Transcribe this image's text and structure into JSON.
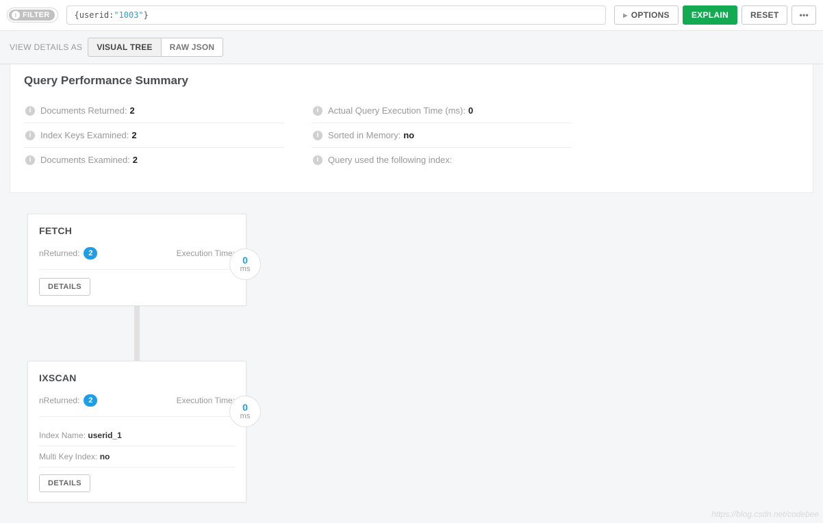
{
  "filter": {
    "badge": "FILTER",
    "query_key": "userid",
    "query_value": "\"1003\"",
    "options_label": "OPTIONS",
    "explain_label": "EXPLAIN",
    "reset_label": "RESET",
    "more_label": "•••"
  },
  "view": {
    "label": "VIEW DETAILS AS",
    "tabs": [
      "VISUAL TREE",
      "RAW JSON"
    ],
    "active_index": 0
  },
  "summary": {
    "title": "Query Performance Summary",
    "left": [
      {
        "label": "Documents Returned:",
        "value": "2"
      },
      {
        "label": "Index Keys Examined:",
        "value": "2"
      },
      {
        "label": "Documents Examined:",
        "value": "2"
      }
    ],
    "right": [
      {
        "label": "Actual Query Execution Time (ms):",
        "value": "0"
      },
      {
        "label": "Sorted in Memory:",
        "value": "no"
      },
      {
        "label": "Query used the following index:",
        "value": ""
      }
    ]
  },
  "plan": {
    "stages": [
      {
        "name": "FETCH",
        "nReturned_label": "nReturned:",
        "nReturned": "2",
        "exec_label": "Execution Time:",
        "exec_value": "0",
        "exec_unit": "ms",
        "details_label": "DETAILS",
        "extra": []
      },
      {
        "name": "IXSCAN",
        "nReturned_label": "nReturned:",
        "nReturned": "2",
        "exec_label": "Execution Time:",
        "exec_value": "0",
        "exec_unit": "ms",
        "details_label": "DETAILS",
        "extra": [
          {
            "label": "Index Name:",
            "value": "userid_1"
          },
          {
            "label": "Multi Key Index:",
            "value": "no"
          }
        ]
      }
    ]
  },
  "watermark": "https://blog.csdn.net/codebee"
}
